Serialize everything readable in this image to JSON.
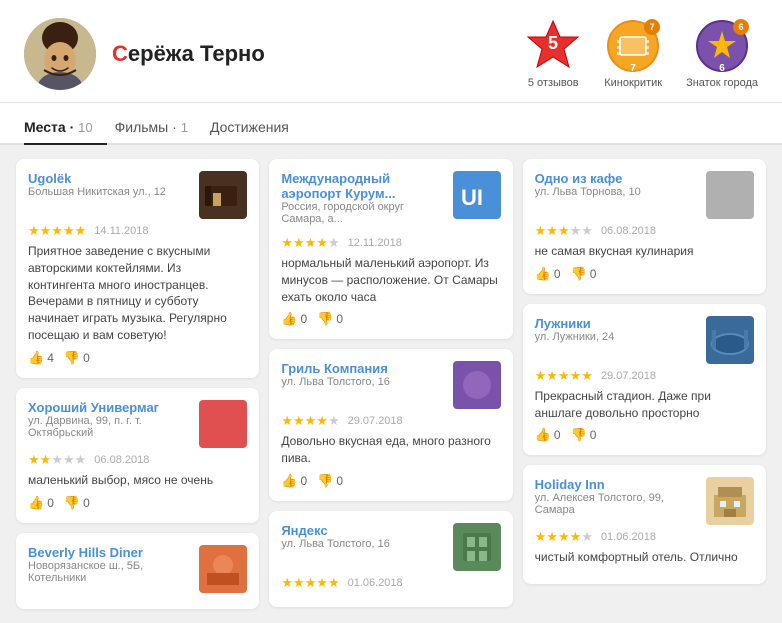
{
  "header": {
    "user_name": "Серёжа Терно",
    "user_name_initial": "С",
    "user_name_rest": "ерёжа Терно"
  },
  "badges": [
    {
      "id": "badge-reviews",
      "number": "5",
      "label": "5 отзывов",
      "num_badge": null
    },
    {
      "id": "badge-film",
      "number": "7",
      "label": "Кинокритик",
      "num_badge": "7"
    },
    {
      "id": "badge-city",
      "number": "6",
      "label": "Знаток города",
      "num_badge": "6"
    }
  ],
  "tabs": [
    {
      "id": "tab-places",
      "label": "Места",
      "count": "10",
      "active": true
    },
    {
      "id": "tab-films",
      "label": "Фильмы",
      "count": "1",
      "active": false
    },
    {
      "id": "tab-achievements",
      "label": "Достижения",
      "count": null,
      "active": false
    }
  ],
  "columns": [
    {
      "cards": [
        {
          "id": "card-ugolok",
          "title": "Ugolёk",
          "subtitle": "Большая Никитская ул., 12",
          "thumb_type": "dark-img",
          "stars": 5,
          "date": "14.11.2018",
          "text": "Приятное заведение с вкусными авторскими коктейлями. Из контингента много иностранцев. Вечерами в пятницу и субботу начинает играть музыка. Регулярно посещаю и вам советую!",
          "likes": 4,
          "dislikes": 0
        },
        {
          "id": "card-univermag",
          "title": "Хороший Универмаг",
          "subtitle": "ул. Дарвина, 99, п. г. т. Октябрьский",
          "thumb_type": "red",
          "stars": 2,
          "date": "06.08.2018",
          "text": "маленький выбор, мясо не очень",
          "likes": 0,
          "dislikes": 0
        },
        {
          "id": "card-beverly",
          "title": "Beverly Hills Diner",
          "subtitle": "Новорязанское ш., 5Б, Котельники",
          "thumb_type": "orange-img",
          "stars": null,
          "date": null,
          "text": null,
          "likes": null,
          "dislikes": null
        }
      ]
    },
    {
      "cards": [
        {
          "id": "card-airport",
          "title": "Международный аэропорт Курум...",
          "subtitle": "Россия, городской округ Самара, а...",
          "thumb_type": "blue-logo",
          "stars": 4,
          "date": "12.11.2018",
          "text": "нормальный маленький аэропорт. Из минусов — расположение. От Самары ехать около часа",
          "likes": 0,
          "dislikes": 0
        },
        {
          "id": "card-grill",
          "title": "Гриль Компания",
          "subtitle": "ул. Льва Толстого, 16",
          "thumb_type": "purple-img",
          "stars": 4,
          "date": "29.07.2018",
          "text": "Довольно вкусная еда, много разного пива.",
          "likes": 0,
          "dislikes": 0
        },
        {
          "id": "card-yandex",
          "title": "Яндекс",
          "subtitle": "ул. Льва Толстого, 16",
          "thumb_type": "building-img",
          "stars": 5,
          "date": "01.06.2018",
          "text": null,
          "likes": null,
          "dislikes": null
        }
      ]
    },
    {
      "cards": [
        {
          "id": "card-cafe",
          "title": "Одно из кафе",
          "subtitle": "ул. Льва Торнова, 10",
          "thumb_type": "gray",
          "stars": 3,
          "date": "06.08.2018",
          "text": "не самая вкусная кулинария",
          "likes": 0,
          "dislikes": 0
        },
        {
          "id": "card-luzhniki",
          "title": "Лужники",
          "subtitle": "ул. Лужники, 24",
          "thumb_type": "stadium-img",
          "stars": 5,
          "date": "29.07.2018",
          "text": "Прекрасный стадион. Даже при аншлаге довольно просторно",
          "likes": 0,
          "dislikes": 0
        },
        {
          "id": "card-holiday",
          "title": "Holiday Inn",
          "subtitle": "ул. Алексея Толстого, 99, Самара",
          "thumb_type": "hotel-img",
          "stars": 4,
          "date": "01.06.2018",
          "text": "чистый комфортный отель. Отлично",
          "likes": null,
          "dislikes": null
        }
      ]
    }
  ]
}
